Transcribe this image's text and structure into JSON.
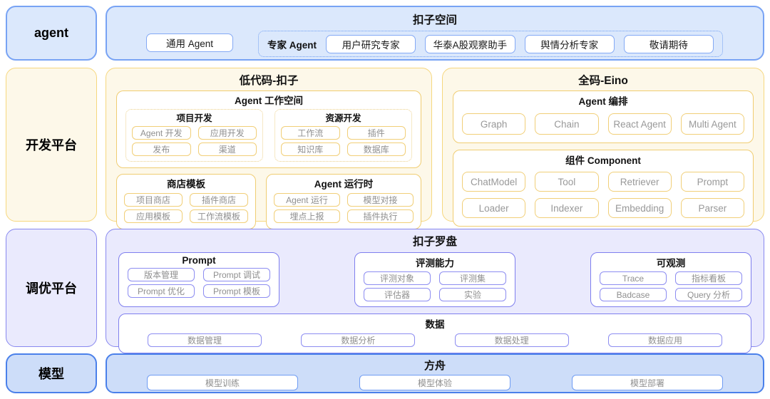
{
  "palette": {
    "blue_fill": "#dbe8fc",
    "blue_border": "#78a3f4",
    "deep_blue_fill": "#cdddf9",
    "deep_blue_border": "#4a80ea",
    "yellow_fill": "#fdf8e9",
    "yellow_border": "#f6d77e",
    "purple_fill": "#eaeafd",
    "purple_border": "#8888ef",
    "chip_text_gray": "#8f8f8f"
  },
  "sidebar": {
    "agent": "agent",
    "dev": "开发平台",
    "tuning": "调优平台",
    "model": "模型"
  },
  "agent_layer": {
    "title": "扣子空间",
    "general": "通用 Agent",
    "expert_label": "专家 Agent",
    "experts": [
      "用户研究专家",
      "华泰A股观察助手",
      "舆情分析专家",
      "敬请期待"
    ]
  },
  "dev_layer": {
    "lowcode": {
      "title": "低代码-扣子",
      "workspace": {
        "title": "Agent 工作空间",
        "project": {
          "title": "项目开发",
          "items": [
            "Agent 开发",
            "应用开发",
            "发布",
            "渠道"
          ]
        },
        "resource": {
          "title": "资源开发",
          "items": [
            "工作流",
            "插件",
            "知识库",
            "数据库"
          ]
        }
      },
      "store": {
        "title": "商店模板",
        "items": [
          "项目商店",
          "插件商店",
          "应用模板",
          "工作流模板"
        ]
      },
      "runtime": {
        "title": "Agent 运行时",
        "items": [
          "Agent 运行",
          "模型对接",
          "埋点上报",
          "插件执行"
        ]
      }
    },
    "fullcode": {
      "title": "全码-Eino",
      "orchestration": {
        "title": "Agent 编排",
        "items": [
          "Graph",
          "Chain",
          "React Agent",
          "Multi Agent"
        ]
      },
      "component": {
        "title": "组件 Component",
        "items": [
          "ChatModel",
          "Tool",
          "Retriever",
          "Prompt",
          "Loader",
          "Indexer",
          "Embedding",
          "Parser"
        ]
      }
    }
  },
  "tuning_layer": {
    "title": "扣子罗盘",
    "prompt": {
      "title": "Prompt",
      "items": [
        "版本管理",
        "Prompt 调试",
        "Prompt 优化",
        "Prompt 模板"
      ]
    },
    "evaluation": {
      "title": "评测能力",
      "items": [
        "评测对象",
        "评测集",
        "评估器",
        "实验"
      ]
    },
    "observability": {
      "title": "可观测",
      "items": [
        "Trace",
        "指标看板",
        "Badcase",
        "Query 分析"
      ]
    },
    "data": {
      "title": "数据",
      "items": [
        "数据管理",
        "数据分析",
        "数据处理",
        "数据应用"
      ]
    }
  },
  "model_layer": {
    "title": "方舟",
    "items": [
      "模型训练",
      "模型体验",
      "模型部署"
    ]
  }
}
